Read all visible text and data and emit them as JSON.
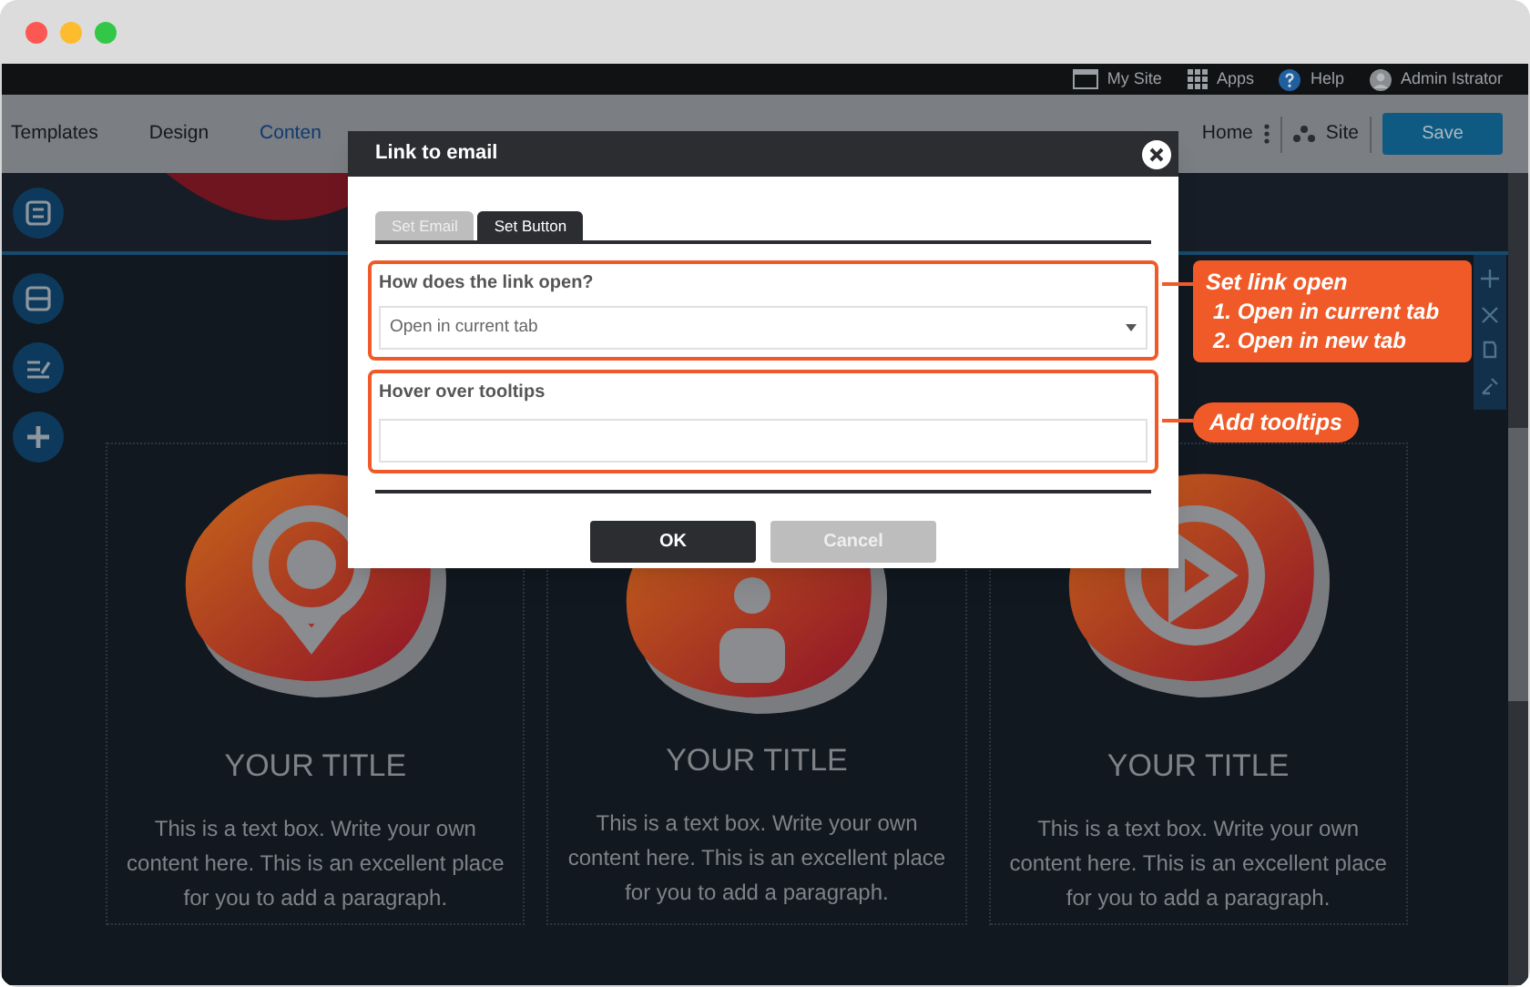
{
  "top_bar": {
    "items": [
      {
        "kind": "site",
        "label": "My Site"
      },
      {
        "kind": "apps",
        "label": "Apps"
      },
      {
        "kind": "help",
        "label": "Help"
      },
      {
        "kind": "user",
        "label": "Admin Istrator"
      }
    ]
  },
  "toolbar": {
    "tabs": [
      {
        "label": "Templates",
        "selected": false
      },
      {
        "label": "Design",
        "selected": false
      },
      {
        "label": "Conten",
        "selected": true
      }
    ],
    "home": "Home",
    "site": "Site",
    "save": "Save"
  },
  "canvas": {
    "columns": [
      {
        "title": "YOUR TITLE",
        "text": "This is a text box. Write your own content here. This is an excellent place for you to add a paragraph."
      },
      {
        "title": "YOUR TITLE",
        "text": "This is a text box. Write your own content here. This is an excellent place for you to add a paragraph."
      },
      {
        "title": "YOUR TITLE",
        "text": "This is a text box. Write your own content here. This is an excellent place for you to add a paragraph."
      }
    ]
  },
  "dialog": {
    "title": "Link to email",
    "tabs": [
      {
        "label": "Set Email",
        "selected": false
      },
      {
        "label": "Set Button",
        "selected": true
      }
    ],
    "fields": [
      {
        "kind": "select",
        "label": "How does the link open?",
        "value": "Open in current tab"
      },
      {
        "kind": "text",
        "label": "Hover over tooltips"
      }
    ],
    "buttons": [
      {
        "kind": "primary",
        "label": "OK"
      },
      {
        "kind": "secondary",
        "label": "Cancel"
      }
    ]
  },
  "callouts": [
    {
      "title": "Set link open",
      "items": [
        "1. Open in current tab",
        "2. Open in new tab"
      ]
    },
    {
      "title": "Add tooltips"
    }
  ]
}
